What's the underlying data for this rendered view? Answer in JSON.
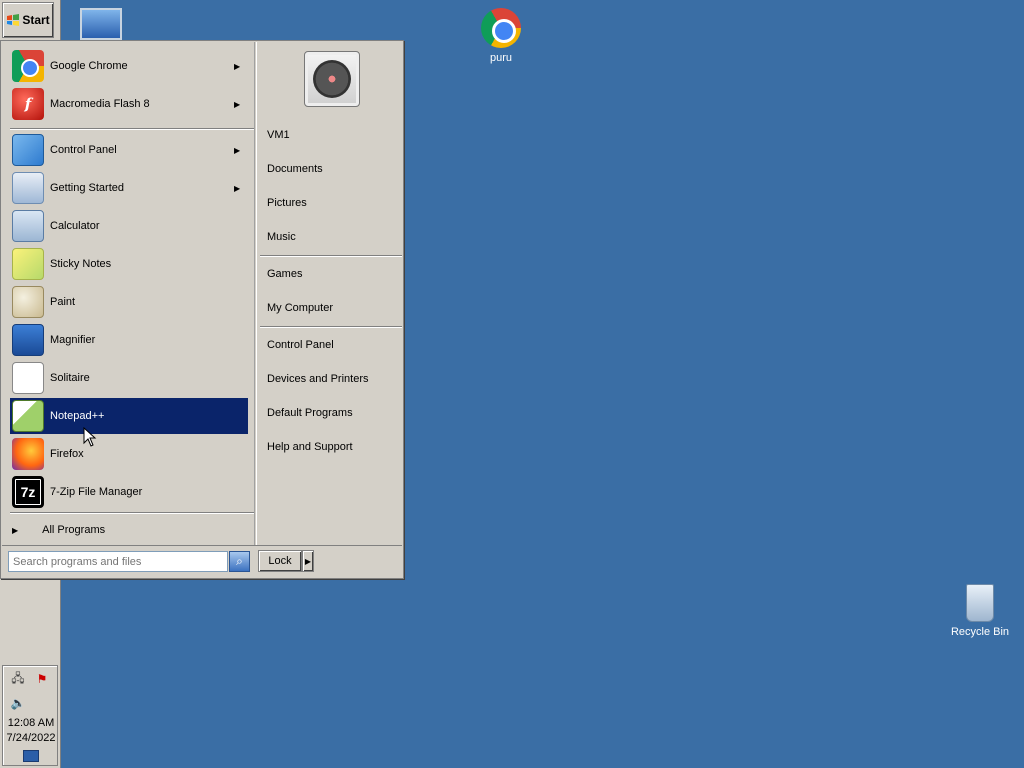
{
  "taskbar": {
    "start_label": "Start",
    "clock_time": "12:08 AM",
    "clock_date": "7/24/2022"
  },
  "desktop": {
    "icons": [
      {
        "label": "puru",
        "icon": "chrome-icon"
      },
      {
        "label": "Recycle Bin",
        "icon": "recycle-bin-icon"
      }
    ]
  },
  "start_menu": {
    "pinned": [
      {
        "label": "Google Chrome",
        "icon": "chrome-icon",
        "submenu": true
      },
      {
        "label": "Macromedia Flash 8",
        "icon": "flash-icon",
        "submenu": true
      }
    ],
    "recent": [
      {
        "label": "Control Panel",
        "icon": "control-panel-icon",
        "submenu": true
      },
      {
        "label": "Getting Started",
        "icon": "getting-started-icon",
        "submenu": true
      },
      {
        "label": "Calculator",
        "icon": "calculator-icon",
        "submenu": false
      },
      {
        "label": "Sticky Notes",
        "icon": "sticky-notes-icon",
        "submenu": false
      },
      {
        "label": "Paint",
        "icon": "paint-icon",
        "submenu": false
      },
      {
        "label": "Magnifier",
        "icon": "magnifier-icon",
        "submenu": false
      },
      {
        "label": "Solitaire",
        "icon": "solitaire-icon",
        "submenu": false
      },
      {
        "label": "Notepad++",
        "icon": "notepad-plus-plus-icon",
        "submenu": false,
        "selected": true
      },
      {
        "label": "Firefox",
        "icon": "firefox-icon",
        "submenu": false
      },
      {
        "label": "7-Zip File Manager",
        "icon": "7zip-icon",
        "submenu": false
      }
    ],
    "all_programs_label": "All Programs",
    "right_items_group1": [
      "VM1",
      "Documents",
      "Pictures",
      "Music"
    ],
    "right_items_group2": [
      "Games",
      "My Computer"
    ],
    "right_items_group3": [
      "Control Panel",
      "Devices and Printers",
      "Default Programs",
      "Help and Support"
    ],
    "search": {
      "placeholder": "Search programs and files",
      "value": ""
    },
    "lock_label": "Lock"
  },
  "colors": {
    "desktop_bg": "#3a6ea5",
    "menu_bg": "#d4d0c8",
    "selection": "#0a246a"
  }
}
